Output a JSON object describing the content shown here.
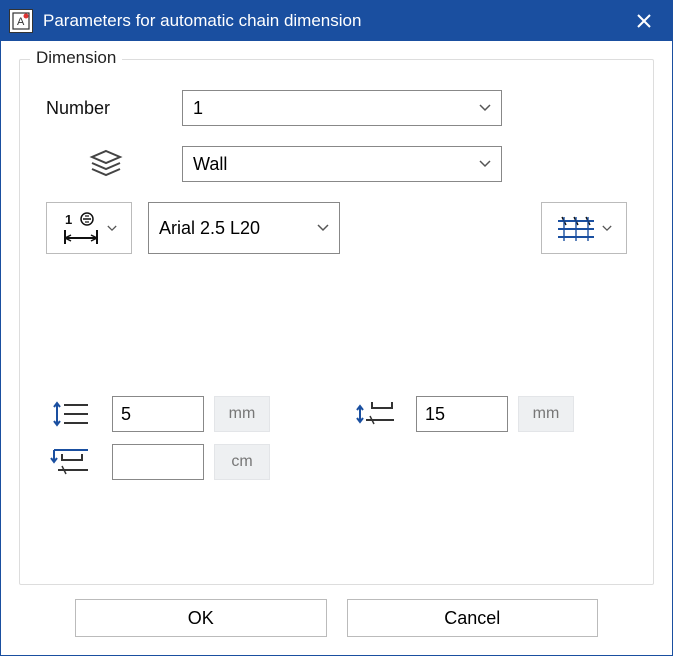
{
  "titlebar": {
    "title": "Parameters for automatic chain dimension"
  },
  "group": {
    "label": "Dimension"
  },
  "fields": {
    "number_label": "Number",
    "number_value": "1",
    "layer_value": "Wall",
    "font_value": "Arial 2.5 L20"
  },
  "inputs": {
    "spacing_value": "5",
    "spacing_unit": "mm",
    "offset_value": "15",
    "offset_unit": "mm",
    "gap_value": "",
    "gap_unit": "cm"
  },
  "buttons": {
    "ok": "OK",
    "cancel": "Cancel"
  }
}
